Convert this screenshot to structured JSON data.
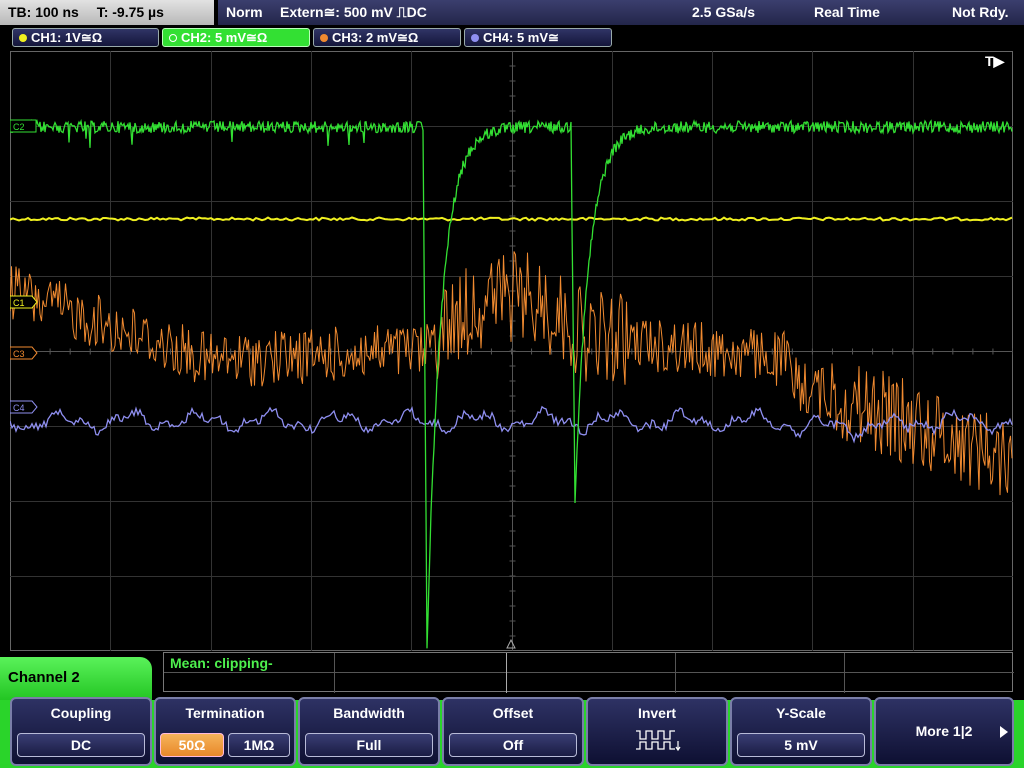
{
  "topbar": {
    "timebase": "TB: 100 ns",
    "trigger_time": "T: -9.75 µs",
    "trigger_mode": "Norm",
    "trigger_source": "Extern≅: 500 mV ⎍DC",
    "sample_rate": "2.5 GSa/s",
    "acq_mode": "Real Time",
    "run_state": "Not Rdy."
  },
  "channels": [
    {
      "label": "CH1: 1V≅Ω",
      "color": "#f0f020"
    },
    {
      "label": "CH2: 5 mV≅Ω",
      "color": "#33e033"
    },
    {
      "label": "CH3: 2 mV≅Ω",
      "color": "#f08a30"
    },
    {
      "label": "CH4: 5 mV≅",
      "color": "#8f8ff0"
    }
  ],
  "markers": {
    "trigger": "T▶",
    "ch1": "C1",
    "ch3": "C3",
    "ch4": "C4",
    "ch2": "C2"
  },
  "measurement": "Mean: clipping-",
  "active_channel": "Channel 2",
  "softkeys": {
    "coupling": {
      "title": "Coupling",
      "value": "DC"
    },
    "termination": {
      "title": "Termination",
      "opt1": "50Ω",
      "opt2": "1MΩ"
    },
    "bandwidth": {
      "title": "Bandwidth",
      "value": "Full"
    },
    "offset": {
      "title": "Offset",
      "value": "Off"
    },
    "invert": {
      "title": "Invert",
      "icon": "inverted-square-wave-icon"
    },
    "yscale": {
      "title": "Y-Scale",
      "value": "5 mV"
    },
    "more": {
      "label": "More 1|2"
    }
  },
  "colors": {
    "ch1": "#f0f020",
    "ch2": "#33e033",
    "ch3": "#f08a30",
    "ch4": "#8f8ff0",
    "grid": "#3a3a3a",
    "softbar": "#2ad42a"
  }
}
